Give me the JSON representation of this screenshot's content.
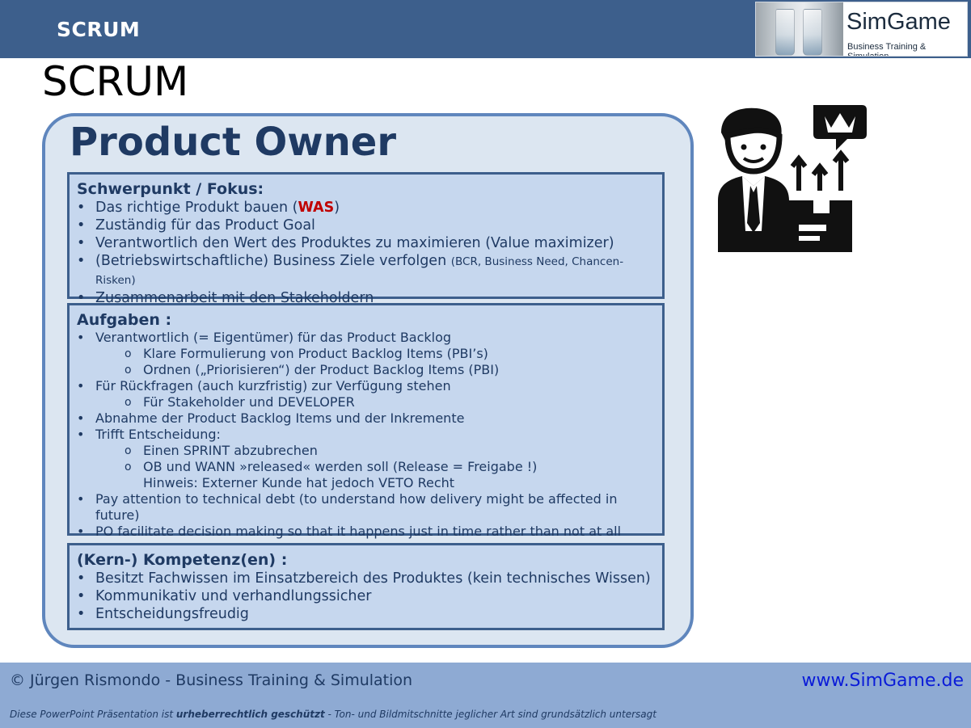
{
  "header": {
    "label": "SCRUM"
  },
  "logo": {
    "title": "SimGame",
    "subtitle": "Business Training & Simulation"
  },
  "slide": {
    "title": "SCRUM"
  },
  "card": {
    "title": "Product Owner",
    "focus": {
      "heading": "Schwerpunkt / Fokus:",
      "item1_pre": "Das richtige Produkt bauen (",
      "item1_highlight": "WAS",
      "item1_post": ")",
      "item2": "Zuständig für das Product Goal",
      "item3": "Verantwortlich den Wert des Produktes zu maximieren (Value maximizer)",
      "item4_main": "(Betriebswirtschaftliche) Business Ziele verfolgen",
      "item4_small": "(BCR, Business Need, Chancen-Risken)",
      "item5": "Zusammenarbeit mit den Stakeholdern"
    },
    "tasks": {
      "heading": "Aufgaben :",
      "items": [
        "Verantwortlich (= Eigentümer) für das Product Backlog",
        "Klare Formulierung von Product Backlog Items (PBI’s)",
        "Ordnen („Priorisieren“) der Product Backlog Items (PBI)",
        "Für Rückfragen (auch kurzfristig) zur Verfügung stehen",
        "Für Stakeholder und DEVELOPER",
        "Abnahme der Product Backlog Items und der Inkremente",
        "Trifft Entscheidung:",
        "Einen SPRINT abzubrechen",
        "OB und WANN »released« werden soll (Release = Freigabe !)",
        "Hinweis: Externer Kunde hat jedoch VETO Recht",
        "Pay attention to technical debt (to understand how delivery might be affected in future)",
        "PO facilitate decision making so that it happens just in time rather than not at all"
      ]
    },
    "competence": {
      "heading": "(Kern-) Kompetenz(en) :",
      "items": [
        "Besitzt Fachwissen im Einsatzbereich des Produktes (kein technisches Wissen)",
        "Kommunikativ und verhandlungssicher",
        "Entscheidungsfreudig"
      ]
    }
  },
  "illustration": {
    "icon": "product-owner-icon"
  },
  "footer": {
    "copyright": "© Jürgen Rismondo - Business Training & Simulation",
    "url": "www.SimGame.de",
    "notice_pre": "Diese PowerPoint Präsentation ist ",
    "notice_bold": "urheberrechtlich geschützt",
    "notice_post": " - Ton- und Bildmitschnitte jeglicher Art sind grundsätzlich untersagt"
  }
}
